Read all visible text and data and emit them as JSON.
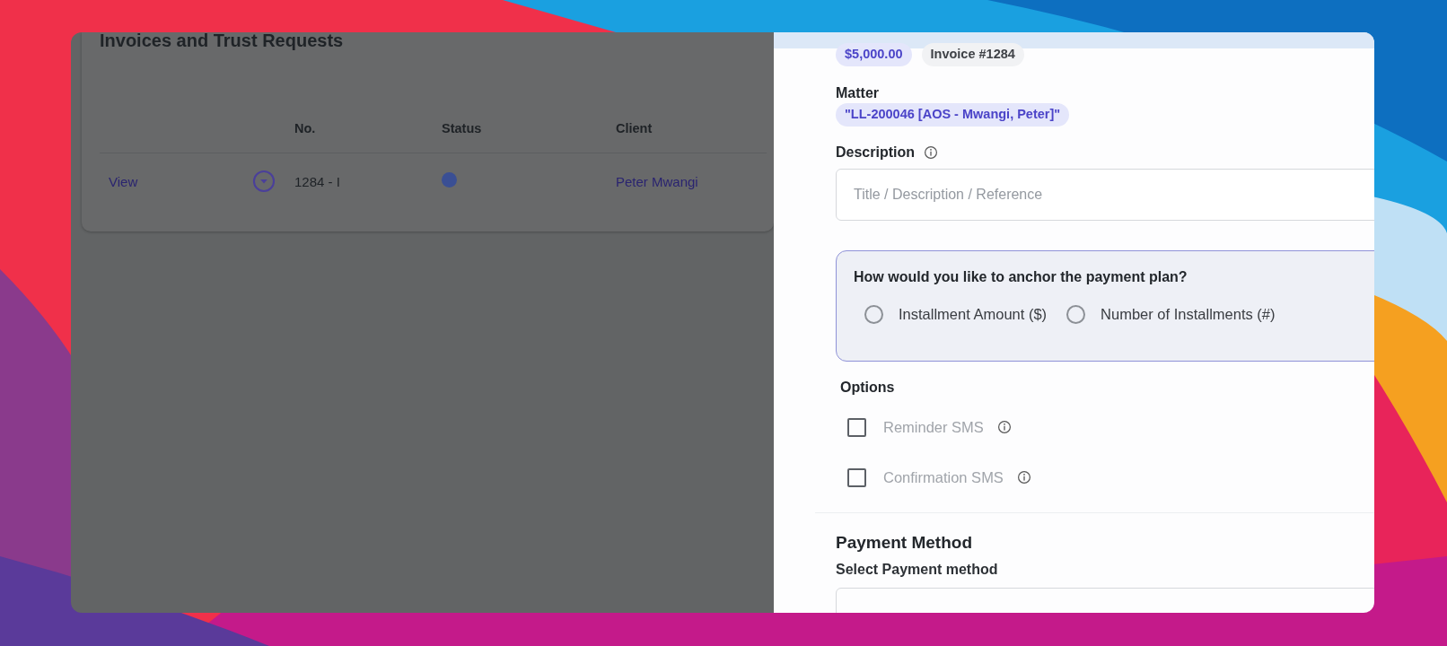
{
  "invoices": {
    "title": "Invoices and Trust Requests",
    "columns": [
      "No.",
      "Status",
      "Client"
    ],
    "rows": [
      {
        "action": "View",
        "expanded": false,
        "number": "1284 - I",
        "client": "Peter Mwangi"
      }
    ]
  },
  "panel": {
    "chips": [
      {
        "text": "$5,000.00",
        "kind": "amount"
      },
      {
        "text": "Invoice #1284",
        "kind": "reference"
      }
    ],
    "matter_label": "Matter",
    "matter": "\"LL-200046 [AOS - Mwangi, Peter]\"",
    "description_label": "Description",
    "description_placeholder": "Title / Description / Reference",
    "anchor": {
      "question": "How would you like to anchor the payment plan?",
      "options": [
        {
          "label": "Installment Amount ($)",
          "selected": false
        },
        {
          "label": "Number of Installments (#)",
          "selected": false
        }
      ]
    },
    "options_label": "Options",
    "options": [
      {
        "label": "Reminder SMS",
        "checked": false
      },
      {
        "label": "Confirmation SMS",
        "checked": false
      }
    ],
    "payment_title": "Payment Method",
    "payment_label": "Select Payment method"
  }
}
